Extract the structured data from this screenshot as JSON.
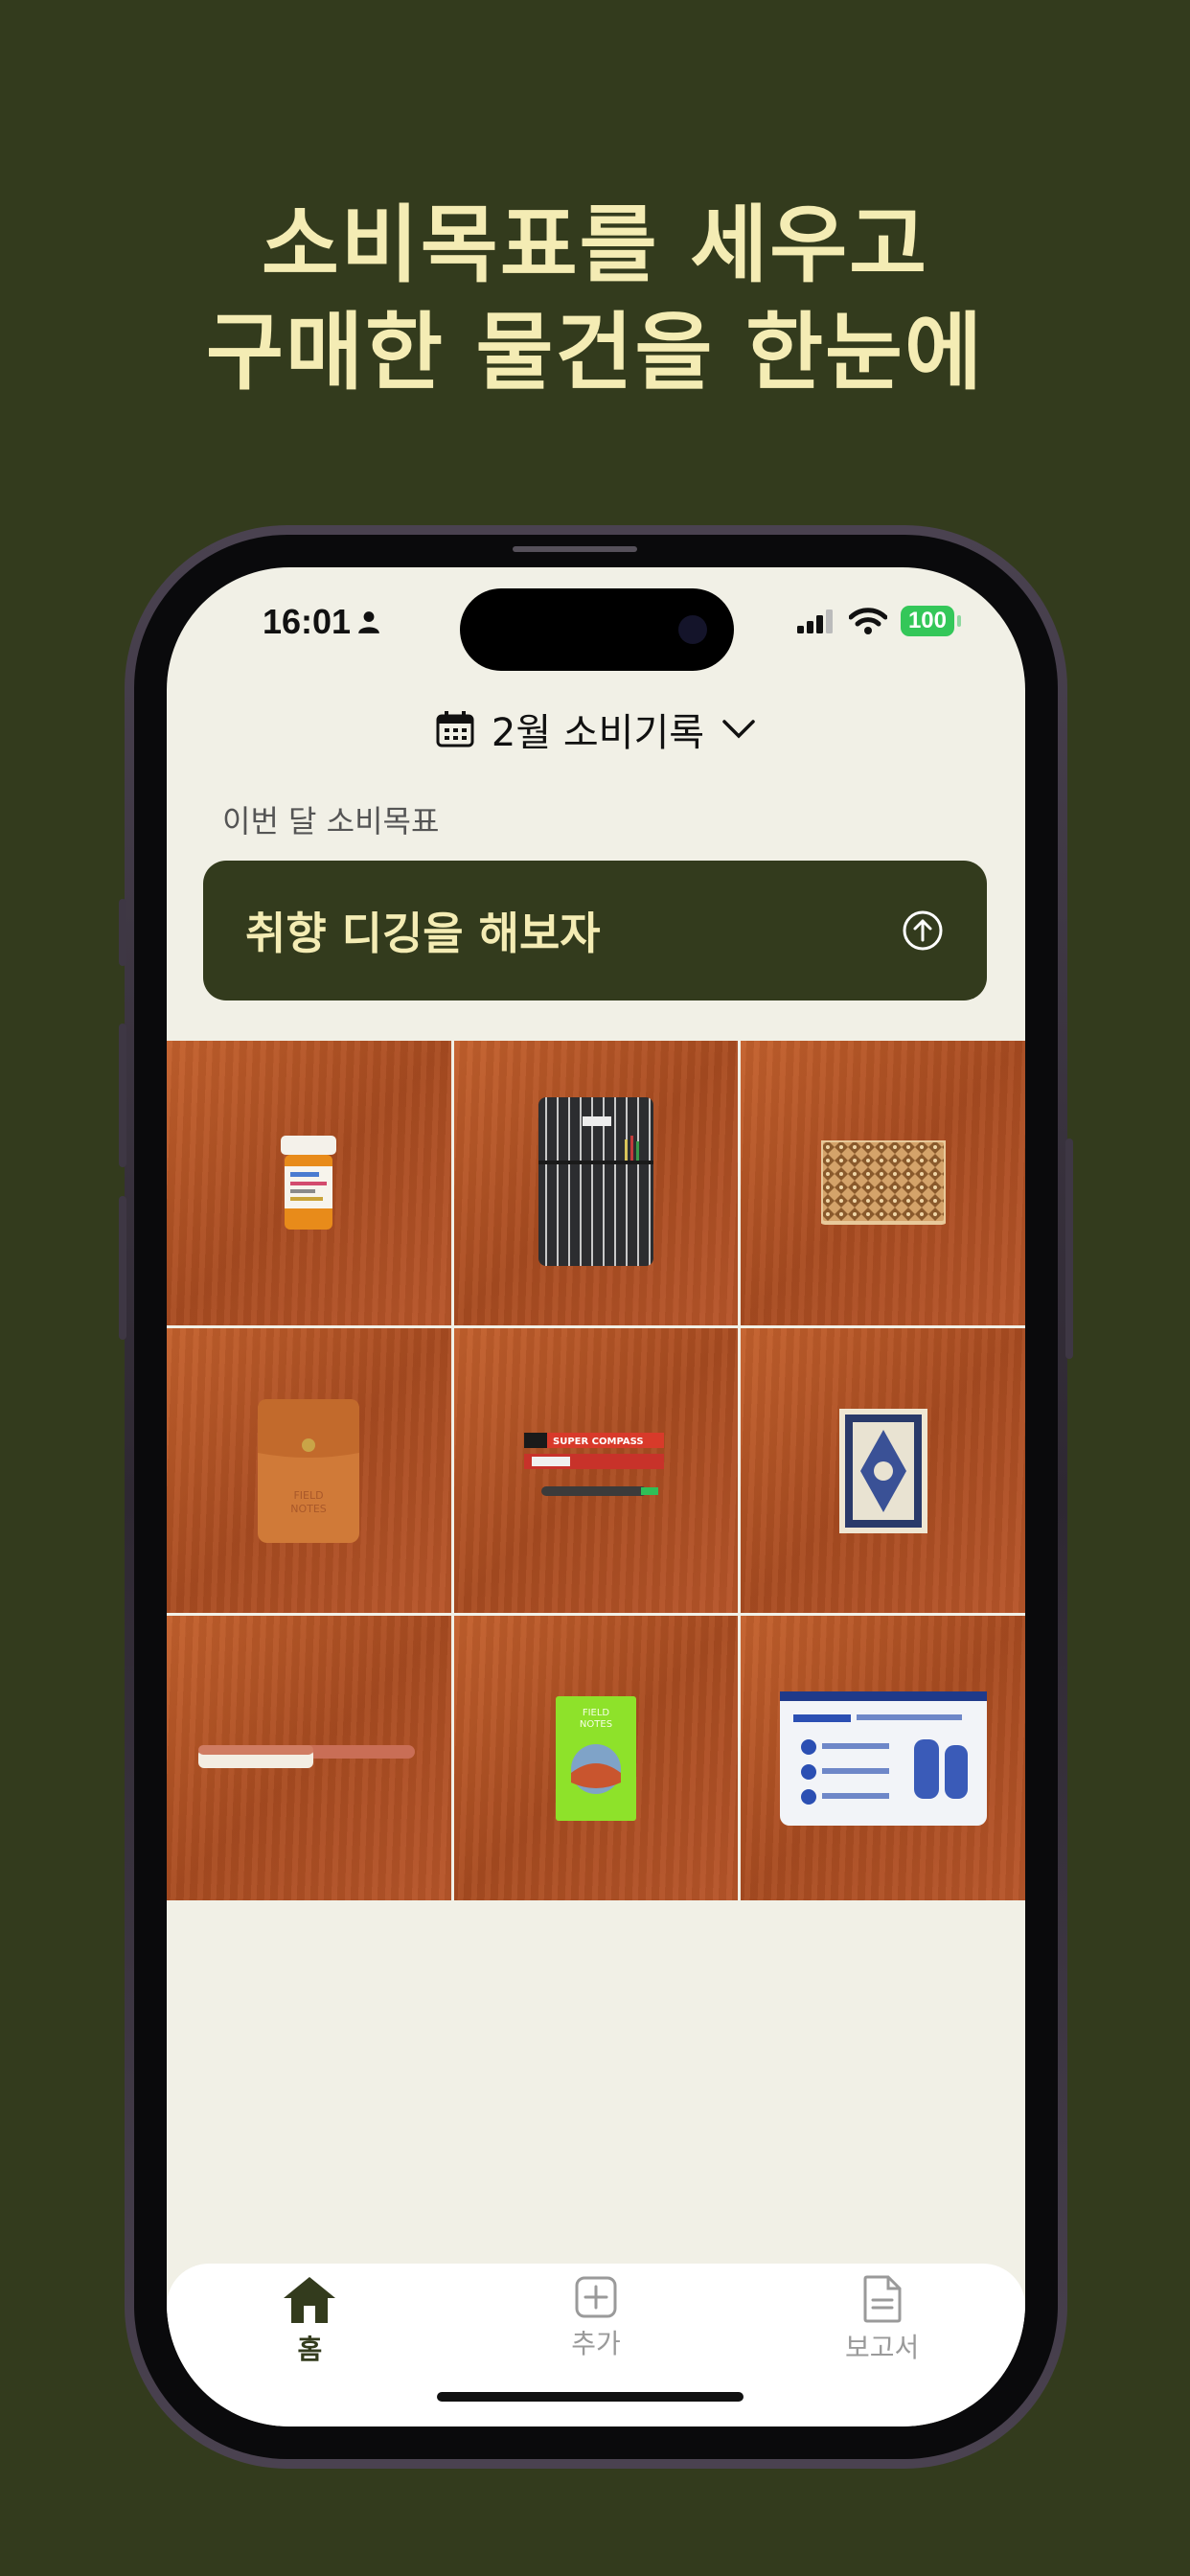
{
  "headline": {
    "line1": "소비목표를 세우고",
    "line2": "구매한 물건을 한눈에"
  },
  "status_bar": {
    "time": "16:01",
    "battery": "100"
  },
  "header": {
    "month_title": "2월 소비기록"
  },
  "goal": {
    "caption": "이번 달 소비목표",
    "text": "취향 디깅을 해보자"
  },
  "grid_items": [
    {
      "icon": "pill-bottle"
    },
    {
      "icon": "striped-pen-case"
    },
    {
      "icon": "puzzle-box"
    },
    {
      "icon": "leather-pouch"
    },
    {
      "icon": "compass-pencils"
    },
    {
      "icon": "mini-rug"
    },
    {
      "icon": "brush"
    },
    {
      "icon": "field-notes"
    },
    {
      "icon": "zip-pouch"
    }
  ],
  "tabs": [
    {
      "label": "홈",
      "icon": "home-icon",
      "active": true
    },
    {
      "label": "추가",
      "icon": "plus-square-icon",
      "active": false
    },
    {
      "label": "보고서",
      "icon": "document-icon",
      "active": false
    }
  ],
  "colors": {
    "brand": "#333b1d",
    "accent": "#f4ecb4",
    "screen_bg": "#f1f0e6",
    "battery": "#34c759"
  }
}
